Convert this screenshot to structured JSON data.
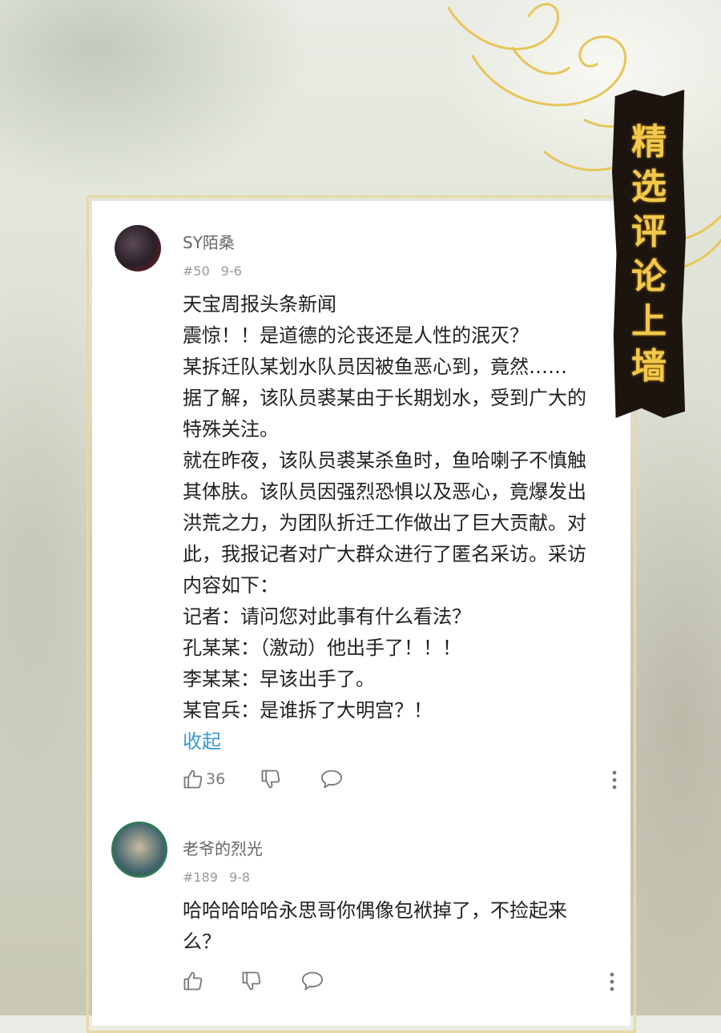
{
  "banner": {
    "chars": [
      "精",
      "选",
      "评",
      "论",
      "上",
      "墙"
    ]
  },
  "comments": [
    {
      "username": "SY陌桑",
      "floor": "#50",
      "date": "9-6",
      "lines": [
        "天宝周报头条新闻",
        "震惊！！是道德的沦丧还是人性的泯灭？",
        "某拆迁队某划水队员因被鱼恶心到，竟然……",
        "据了解，该队员裘某由于长期划水，受到广大的",
        "特殊关注。",
        "就在昨夜，该队员裘某杀鱼时，鱼哈喇子不慎触",
        "其体肤。该队员因强烈恐惧以及恶心，竟爆发出",
        "洪荒之力，为团队折迁工作做出了巨大贡献。对",
        "此，我报记者对广大群众进行了匿名采访。采访",
        "内容如下：",
        "记者：请问您对此事有什么看法？",
        "孔某某：（激动）他出手了！！！",
        "李某某：早该出手了。",
        "某官兵：是谁拆了大明宫？！"
      ],
      "collapse_label": "收起",
      "like_count": "36"
    },
    {
      "username": "老爷的烈光",
      "floor": "#189",
      "date": "9-8",
      "lines": [
        "哈哈哈哈哈永思哥你偶像包袱掉了，不捡起来",
        "么？"
      ]
    }
  ],
  "colors": {
    "link": "#3a98d4",
    "title_gold": "#f2c94c",
    "banner_bg": "#1c140f",
    "frame_gold": "#e7d9a6"
  }
}
